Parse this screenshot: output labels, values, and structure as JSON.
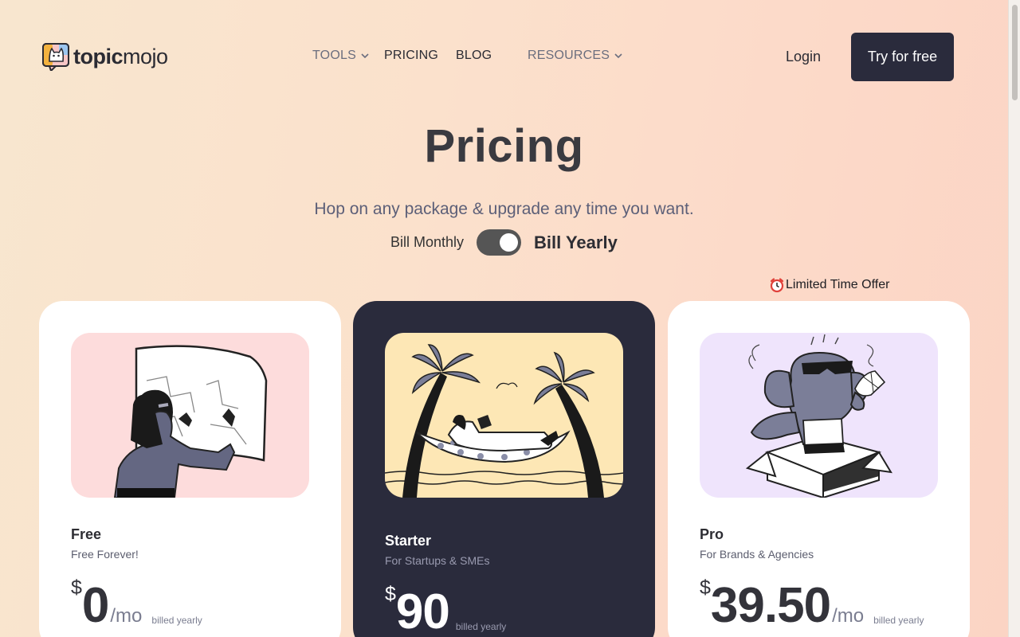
{
  "brand": {
    "bold": "topic",
    "light": "mojo"
  },
  "nav": {
    "tools": "TOOLS",
    "pricing": "PRICING",
    "blog": "BLOG",
    "resources": "RESOURCES"
  },
  "header": {
    "login": "Login",
    "cta": "Try for free"
  },
  "hero": {
    "title": "Pricing",
    "subtitle": "Hop on any package & upgrade any time you want.",
    "bill_monthly": "Bill Monthly",
    "bill_yearly": "Bill Yearly",
    "yearly_selected": true
  },
  "offer": {
    "icon": "alarm-clock-icon",
    "label": "Limited Time Offer"
  },
  "plans": [
    {
      "name": "Free",
      "desc": "Free Forever!",
      "currency": "$",
      "amount": "0",
      "per": "/mo",
      "billed": "billed yearly",
      "image": "woman-drawing-map-illustration",
      "bg": "#fddcdc"
    },
    {
      "name": "Starter",
      "desc": "For Startups & SMEs",
      "currency": "$",
      "amount": "90",
      "per": "",
      "billed": "billed yearly",
      "image": "hammock-palm-trees-illustration",
      "bg": "#fde7b5"
    },
    {
      "name": "Pro",
      "desc": "For Brands & Agencies",
      "currency": "$",
      "amount": "39.50",
      "per": "/mo",
      "billed": "billed yearly",
      "image": "elephant-in-box-illustration",
      "bg": "#efe4fc"
    }
  ],
  "colors": {
    "dark": "#2a2b3c",
    "accent_text": "#5c5f78"
  }
}
